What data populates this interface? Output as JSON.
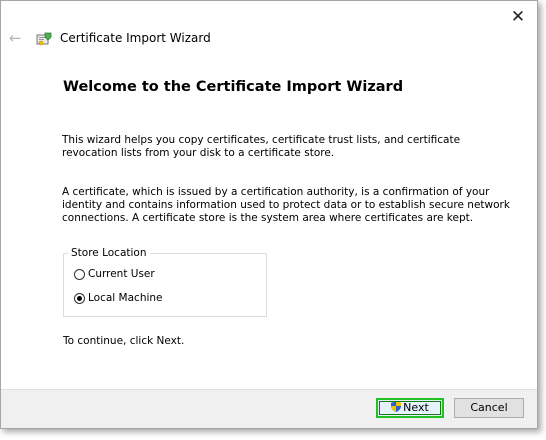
{
  "window": {
    "close_glyph": "✕",
    "back_glyph": "←",
    "title": "Certificate Import Wizard"
  },
  "main": {
    "heading": "Welcome to the Certificate Import Wizard",
    "paragraph1": "This wizard helps you copy certificates, certificate trust lists, and certificate revocation lists from your disk to a certificate store.",
    "paragraph2": "A certificate, which is issued by a certification authority, is a confirmation of your identity and contains information used to protect data or to establish secure network connections. A certificate store is the system area where certificates are kept.",
    "store_location": {
      "legend": "Store Location",
      "options": [
        {
          "label": "Current User",
          "selected": false
        },
        {
          "label": "Local Machine",
          "selected": true
        }
      ]
    },
    "continue_text": "To continue, click Next."
  },
  "footer": {
    "next_label": "Next",
    "cancel_label": "Cancel"
  },
  "colors": {
    "highlight": "#22c022"
  }
}
